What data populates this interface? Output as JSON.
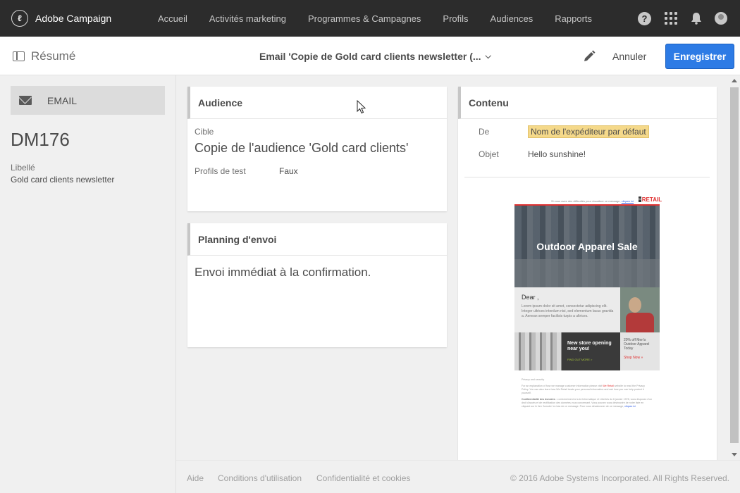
{
  "app": {
    "brand": "Adobe Campaign",
    "logo_glyph": "ℓ"
  },
  "nav": {
    "links": [
      "Accueil",
      "Activités marketing",
      "Programmes & Campagnes",
      "Profils",
      "Audiences",
      "Rapports"
    ],
    "icons": [
      "help-icon",
      "apps-grid-icon",
      "bell-icon",
      "user-avatar-icon"
    ],
    "help_glyph": "?"
  },
  "subheader": {
    "summary_label": "Résumé",
    "title": "Email 'Copie de Gold card clients newsletter (...",
    "cancel_label": "Annuler",
    "save_label": "Enregistrer"
  },
  "sidebar": {
    "channel_label": "EMAIL",
    "code": "DM176",
    "label_caption": "Libellé",
    "label_value": "Gold card clients newsletter"
  },
  "audience": {
    "title": "Audience",
    "target_caption": "Cible",
    "target_value": "Copie de l'audience 'Gold card clients'",
    "test_profiles_caption": "Profils de test",
    "test_profiles_value": "Faux"
  },
  "planning": {
    "title": "Planning d'envoi",
    "text": "Envoi immédiat à la confirmation."
  },
  "contenu": {
    "title": "Contenu",
    "from_caption": "De",
    "from_value": "Nom de l'expéditeur par défaut",
    "subject_caption": "Objet",
    "subject_value": "Hello sunshine!"
  },
  "preview": {
    "topline": "Si vous avez des difficultés pour visualiser ce message, ",
    "topline_link": "cliquez ici",
    "logo_box": "W",
    "logo_text": "RETAIL",
    "hero_text": "Outdoor Apparel Sale",
    "dear": "Dear ,",
    "lorem": "Lorem ipsum dolor sit amet, consectetur adipiscing elit. Integer ultrices interdum nisi, sed elementum lacus gravida a. Aenean semper facilisis turpis a ultrices.",
    "store_title": "New store opening near you!",
    "store_cta": "FIND OUT MORE  >",
    "promo_text": "20% off Men's Outdoor Apparel Today",
    "promo_cta": "Shop Now »",
    "footer_line1": "Privacy and security",
    "footer_line2": "For an explanation of how we manage customer information please visit ",
    "footer_brand": "We Retail",
    "footer_line2b": " website to read the Privacy Policy. You can also learn how We Retail treats your personal information and ask how you can help protect it yourself.",
    "footer_conf_title": "Confidentialité des données",
    "footer_conf": " : conformément à la loi Informatique et Libertés du 6 janvier 1978, vous disposez d'un droit d'accès et de rectification des données vous concernant. Vous pouvez vous désinscrire de notre liste en cliquant sur le lien 'Annuler' en bas de ce message. Pour vous désabonner de ce message, ",
    "footer_unsub": "cliquez ici"
  },
  "footer": {
    "help": "Aide",
    "terms": "Conditions d'utilisation",
    "privacy": "Confidentialité et cookies",
    "copyright": "© 2016 Adobe Systems Incorporated. All Rights Reserved."
  },
  "colors": {
    "topbar": "#2c2c2c",
    "primary": "#2d7be5",
    "highlight": "#f5d98a"
  }
}
